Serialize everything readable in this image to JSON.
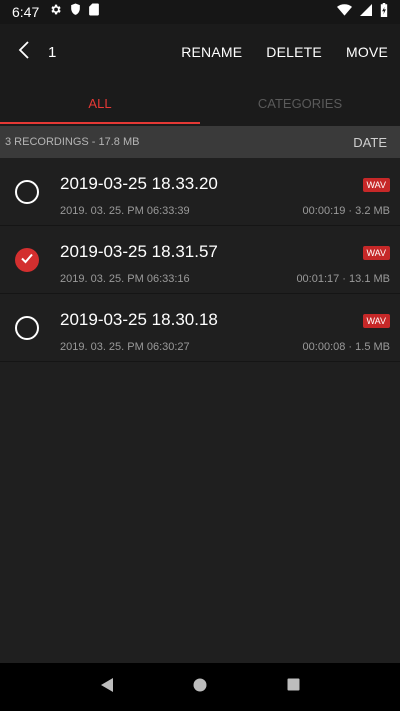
{
  "status_bar": {
    "time": "6:47"
  },
  "action_bar": {
    "selected_count": "1",
    "rename_label": "RENAME",
    "delete_label": "DELETE",
    "move_label": "MOVE"
  },
  "tabs": [
    {
      "label": "ALL",
      "active": true
    },
    {
      "label": "CATEGORIES",
      "active": false
    }
  ],
  "summary": {
    "text": "3 RECORDINGS - 17.8 MB",
    "sort_label": "DATE"
  },
  "recordings": [
    {
      "title": "2019-03-25 18.33.20",
      "date": "2019. 03. 25. PM 06:33:39",
      "format": "WAV",
      "meta": "00:00:19 · 3.2 MB",
      "checked": false
    },
    {
      "title": "2019-03-25 18.31.57",
      "date": "2019. 03. 25. PM 06:33:16",
      "format": "WAV",
      "meta": "00:01:17 · 13.1 MB",
      "checked": true
    },
    {
      "title": "2019-03-25 18.30.18",
      "date": "2019. 03. 25. PM 06:30:27",
      "format": "WAV",
      "meta": "00:00:08 · 1.5 MB",
      "checked": false
    }
  ],
  "colors": {
    "accent": "#e53935",
    "badge": "#c62828",
    "background": "#1f1f1f"
  },
  "icons": {
    "status": [
      "gear-icon",
      "shield-icon",
      "sd-card-icon",
      "wifi-icon",
      "signal-icon",
      "battery-icon"
    ],
    "nav": [
      "back-triangle-icon",
      "home-circle-icon",
      "recents-square-icon"
    ]
  }
}
